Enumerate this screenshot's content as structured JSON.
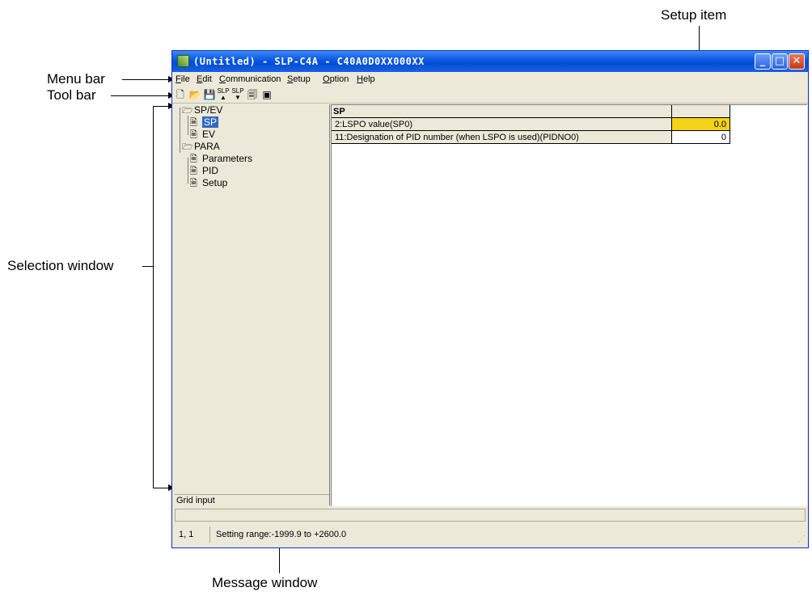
{
  "callouts": {
    "setup_item": "Setup item",
    "menu_bar": "Menu bar",
    "tool_bar": "Tool bar",
    "selection_window": "Selection window",
    "message_window": "Message window"
  },
  "window": {
    "title": "(Untitled) - SLP-C4A - C40A0D0XX000XX",
    "minimize": "_",
    "maximize": "□",
    "close": "✕"
  },
  "menu": [
    {
      "acc": "F",
      "rest": "ile"
    },
    {
      "acc": "E",
      "rest": "dit"
    },
    {
      "acc": "C",
      "rest": "ommunication"
    },
    {
      "acc": "S",
      "rest": "etup"
    },
    {
      "acc": "O",
      "rest": "ption"
    },
    {
      "acc": "H",
      "rest": "elp"
    }
  ],
  "toolbar_icons": [
    "new-file-icon",
    "open-folder-icon",
    "save-icon",
    "upload-slp-icon",
    "download-slp-icon",
    "properties-icon",
    "window-icon"
  ],
  "tree": {
    "spev": "SP/EV",
    "sp": "SP",
    "ev": "EV",
    "para": "PARA",
    "parameters": "Parameters",
    "pid": "PID",
    "setup": "Setup"
  },
  "grid_input": "Grid input",
  "grid": {
    "header": "SP",
    "rows": [
      {
        "label": "2:LSPO value(SP0)",
        "value": "0.0"
      },
      {
        "label": "11:Designation of PID number (when LSPO is used)(PIDNO0)",
        "value": "0"
      }
    ]
  },
  "status": {
    "position": "1, 1",
    "message": "Setting range:-1999.9 to +2600.0"
  }
}
